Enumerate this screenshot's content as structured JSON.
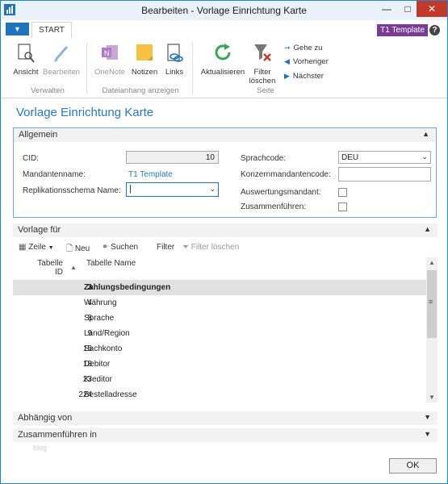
{
  "window": {
    "title": "Bearbeiten - Vorlage Einrichtung Karte"
  },
  "ribbon": {
    "tab": "START",
    "company_badge": "T1 Template",
    "help": "?",
    "buttons": {
      "ansicht": "Ansicht",
      "bearbeiten": "Bearbeiten",
      "onenote": "OneNote",
      "notizen": "Notizen",
      "links": "Links",
      "aktualisieren": "Aktualisieren",
      "filter_loeschen_1": "Filter",
      "filter_loeschen_2": "löschen"
    },
    "nav": {
      "gehe_zu": "Gehe zu",
      "vorheriger": "Vorheriger",
      "naechster": "Nächster"
    },
    "groups": {
      "verwalten": "Verwalten",
      "dateianhang": "Dateianhang anzeigen",
      "seite": "Seite"
    }
  },
  "page_title": "Vorlage Einrichtung Karte",
  "allgemein": {
    "header": "Allgemein",
    "cid_label": "CID:",
    "cid_value": "10",
    "mandantenname_label": "Mandantenname:",
    "mandantenname_value": "T1 Template",
    "replikationsschema_label": "Replikationsschema Name:",
    "replikationsschema_value": "",
    "sprachcode_label": "Sprachcode:",
    "sprachcode_value": "DEU",
    "konzern_label": "Konzernmandantencode:",
    "konzern_value": "",
    "auswertung_label": "Auswertungsmandant:",
    "auswertung_checked": false,
    "zusammen_label": "Zusammenführen:",
    "zusammen_checked": false
  },
  "vorlage_fuer": {
    "header": "Vorlage für",
    "toolbar": {
      "zeile": "Zeile",
      "neu": "Neu",
      "suchen": "Suchen",
      "filter": "Filter",
      "filter_loeschen": "Filter löschen"
    },
    "columns": {
      "tabelle_id_1": "Tabelle",
      "tabelle_id_2": "ID",
      "tabelle_name": "Tabelle Name"
    },
    "rows": [
      {
        "id": "3",
        "name": "Zahlungsbedingungen"
      },
      {
        "id": "4",
        "name": "Währung"
      },
      {
        "id": "8",
        "name": "Sprache"
      },
      {
        "id": "9",
        "name": "Land/Region"
      },
      {
        "id": "15",
        "name": "Sachkonto"
      },
      {
        "id": "18",
        "name": "Debitor"
      },
      {
        "id": "23",
        "name": "Kreditor"
      },
      {
        "id": "224",
        "name": "Bestelladresse"
      }
    ]
  },
  "abhaengig_von": {
    "header": "Abhängig von"
  },
  "zusammenfuehren_in": {
    "header": "Zusammenführen in"
  },
  "watermark": "blog",
  "ok_button": "OK"
}
